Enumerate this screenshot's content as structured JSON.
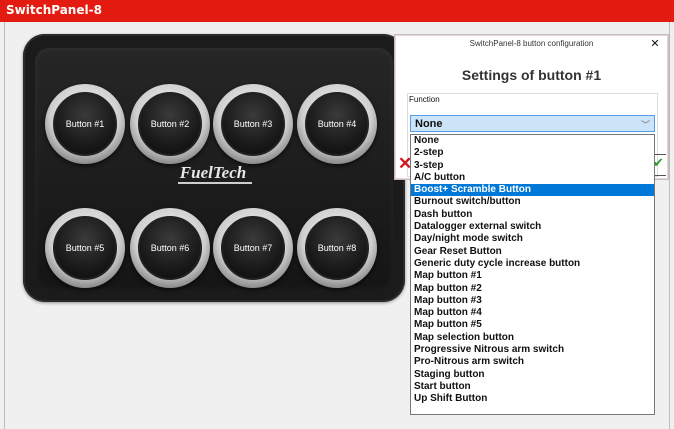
{
  "app": {
    "title": "SwitchPanel-8"
  },
  "panel": {
    "logo_text": "FuelTech",
    "buttons": [
      "Button #1",
      "Button #2",
      "Button #3",
      "Button #4",
      "Button #5",
      "Button #6",
      "Button #7",
      "Button #8"
    ]
  },
  "dialog": {
    "window_title": "SwitchPanel-8 button configuration",
    "close_glyph": "✕",
    "heading": "Settings of button #1",
    "function_label": "Function",
    "selected_value": "None",
    "cancel_glyph": "✕",
    "ok_glyph": "✔",
    "options": [
      "None",
      "2-step",
      "3-step",
      "A/C button",
      "Boost+ Scramble Button",
      "Burnout switch/button",
      "Dash button",
      "Datalogger external switch",
      "Day/night mode switch",
      "Gear Reset Button",
      "Generic duty cycle increase button",
      "Map button #1",
      "Map button #2",
      "Map button #3",
      "Map button #4",
      "Map button #5",
      "Map selection button",
      "Progressive Nitrous arm switch",
      "Pro-Nitrous arm switch",
      "Staging button",
      "Start button",
      "Up Shift Button"
    ],
    "highlighted_option": "Boost+ Scramble Button",
    "colors": {
      "titlebar": "#e31b10",
      "highlight": "#0078d7",
      "select_bg": "#cce4f7"
    }
  }
}
